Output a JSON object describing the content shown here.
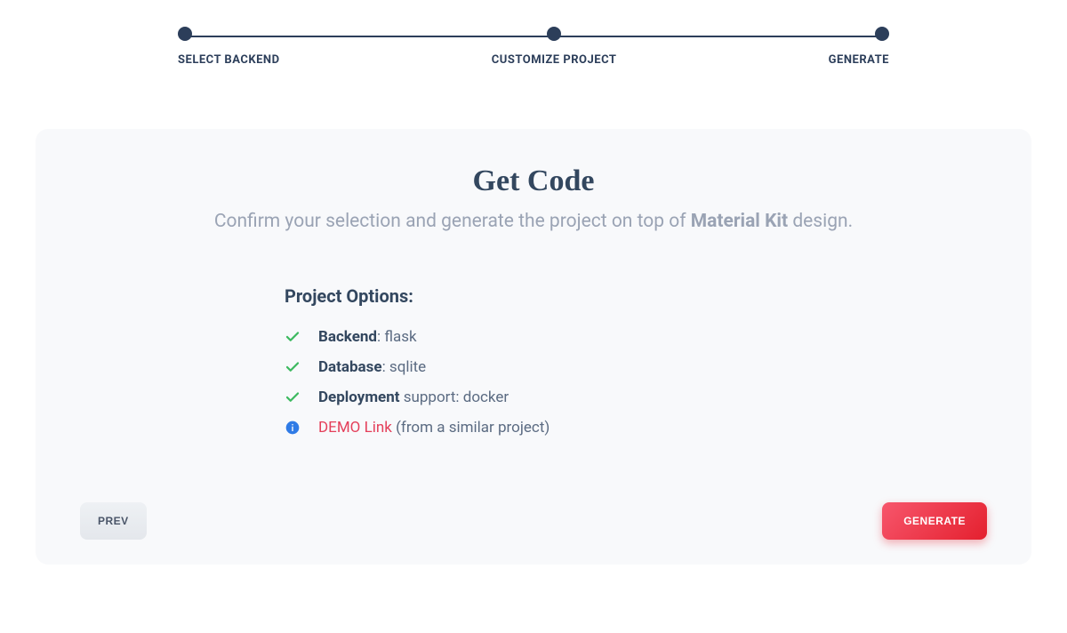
{
  "stepper": {
    "steps": [
      {
        "label": "SELECT BACKEND"
      },
      {
        "label": "CUSTOMIZE PROJECT"
      },
      {
        "label": "GENERATE"
      }
    ]
  },
  "header": {
    "title": "Get Code",
    "subtitle_prefix": "Confirm your selection and generate the project on top of ",
    "subtitle_strong": "Material Kit",
    "subtitle_suffix": " design."
  },
  "options": {
    "heading": "Project Options:",
    "items": [
      {
        "icon": "check",
        "label": "Backend",
        "label_suffix": ": ",
        "value": "flask"
      },
      {
        "icon": "check",
        "label": "Database",
        "label_suffix": ": ",
        "value": "sqlite"
      },
      {
        "icon": "check",
        "label": "Deployment",
        "label_suffix": " support: ",
        "value": "docker"
      }
    ],
    "demo": {
      "icon": "info",
      "link_text": "DEMO Link",
      "hint": " (from a similar project)"
    }
  },
  "footer": {
    "prev_label": "PREV",
    "generate_label": "GENERATE"
  }
}
